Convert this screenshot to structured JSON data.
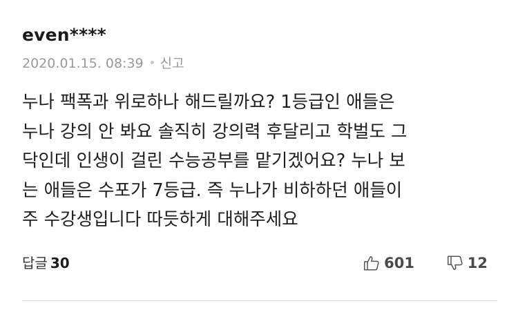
{
  "comment": {
    "username": "even****",
    "timestamp": "2020.01.15. 08:39",
    "report_label": "신고",
    "body_lines": [
      "누나 팩폭과 위로하나 해드릴까요? 1등급인 애들은",
      "누나 강의 안 봐요 솔직히 강의력 후달리고 학벌도 그",
      "닥인데 인생이 걸린 수능공부를 맡기겠어요? 누나 보",
      "는 애들은 수포가 7등급. 즉 누나가 비하하던 애들이",
      "주 수강생입니다 따듯하게 대해주세요"
    ],
    "reply_label": "답글",
    "reply_count": "30",
    "like_count": "601",
    "dislike_count": "12",
    "like_icon": "thumbs-up-icon",
    "dislike_icon": "thumbs-down-icon"
  },
  "colors": {
    "text": "#1e1e1e",
    "meta": "#9a9a9a",
    "icon": "#555555",
    "divider": "#dcdcdc"
  }
}
